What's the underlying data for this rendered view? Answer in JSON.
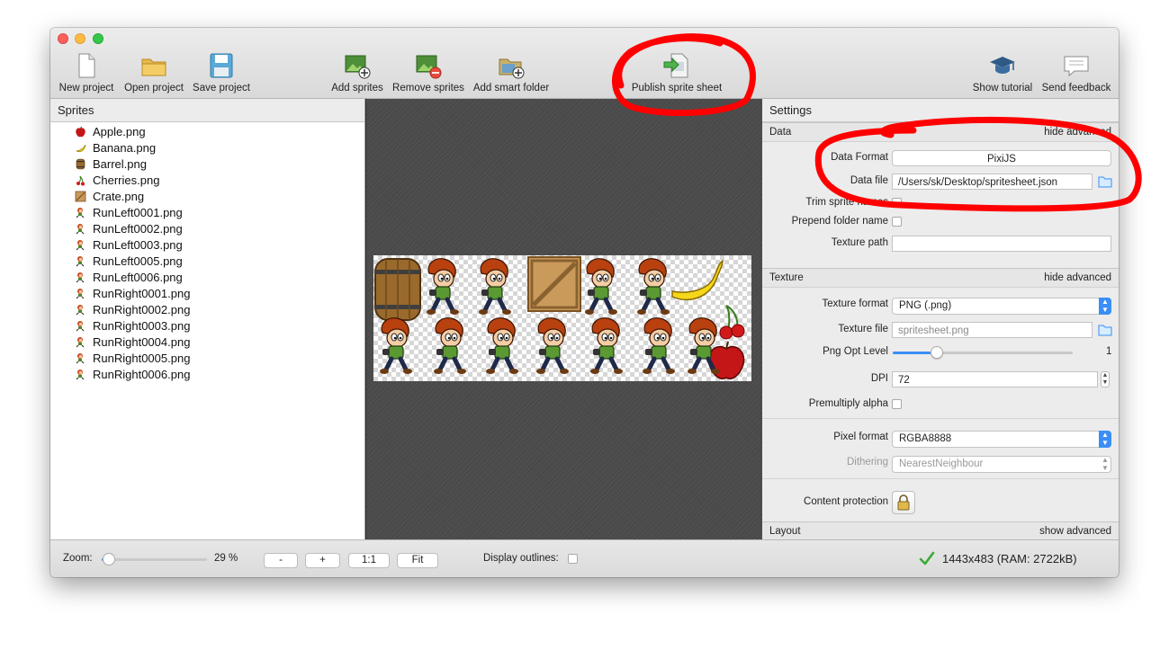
{
  "toolbar": {
    "buttons": [
      {
        "label": "New project"
      },
      {
        "label": "Open project"
      },
      {
        "label": "Save project"
      },
      {
        "label": "Add sprites"
      },
      {
        "label": "Remove sprites"
      },
      {
        "label": "Add smart folder"
      },
      {
        "label": "Publish sprite sheet"
      },
      {
        "label": "Show tutorial"
      },
      {
        "label": "Send feedback"
      }
    ]
  },
  "sidebar": {
    "title": "Sprites",
    "items": [
      {
        "label": "Apple.png",
        "icon": "apple-icon"
      },
      {
        "label": "Banana.png",
        "icon": "banana-icon"
      },
      {
        "label": "Barrel.png",
        "icon": "barrel-icon"
      },
      {
        "label": "Cherries.png",
        "icon": "cherries-icon"
      },
      {
        "label": "Crate.png",
        "icon": "crate-icon"
      },
      {
        "label": "RunLeft0001.png",
        "icon": "character-icon"
      },
      {
        "label": "RunLeft0002.png",
        "icon": "character-icon"
      },
      {
        "label": "RunLeft0003.png",
        "icon": "character-icon"
      },
      {
        "label": "RunLeft0005.png",
        "icon": "character-icon"
      },
      {
        "label": "RunLeft0006.png",
        "icon": "character-icon"
      },
      {
        "label": "RunRight0001.png",
        "icon": "character-icon"
      },
      {
        "label": "RunRight0002.png",
        "icon": "character-icon"
      },
      {
        "label": "RunRight0003.png",
        "icon": "character-icon"
      },
      {
        "label": "RunRight0004.png",
        "icon": "character-icon"
      },
      {
        "label": "RunRight0005.png",
        "icon": "character-icon"
      },
      {
        "label": "RunRight0006.png",
        "icon": "character-icon"
      }
    ]
  },
  "settings": {
    "title": "Settings",
    "data": {
      "title": "Data",
      "toggle": "hide advanced",
      "data_format_label": "Data Format",
      "data_format": "PixiJS",
      "data_file_label": "Data file",
      "data_file": "/Users/sk/Desktop/spritesheet.json",
      "trim_label": "Trim sprite names",
      "prepend_label": "Prepend folder name",
      "texture_path_label": "Texture path",
      "texture_path": ""
    },
    "texture": {
      "title": "Texture",
      "toggle": "hide advanced",
      "texture_format_label": "Texture format",
      "texture_format": "PNG (.png)",
      "texture_file_label": "Texture file",
      "texture_file": "spritesheet.png",
      "png_opt_label": "Png Opt Level",
      "png_opt_value": "1",
      "png_opt_level": 1,
      "png_opt_max": 7,
      "dpi_label": "DPI",
      "dpi": "72",
      "premultiply_label": "Premultiply alpha",
      "pixel_format_label": "Pixel format",
      "pixel_format": "RGBA8888",
      "dithering_label": "Dithering",
      "dithering": "NearestNeighbour",
      "content_protection_label": "Content protection"
    },
    "layout": {
      "title": "Layout",
      "toggle": "show advanced"
    }
  },
  "statusbar": {
    "zoom_label": "Zoom:",
    "zoom_value": "29 %",
    "zoom_percent": 29,
    "btn_minus": "-",
    "btn_plus": "+",
    "btn_1to1": "1:1",
    "btn_fit": "Fit",
    "outlines_label": "Display outlines:",
    "status": "1443x483 (RAM: 2722kB)"
  },
  "colors": {
    "accent": "#3a8ef6",
    "annotation": "#ff0000",
    "canvas": "#4b4b4b"
  }
}
